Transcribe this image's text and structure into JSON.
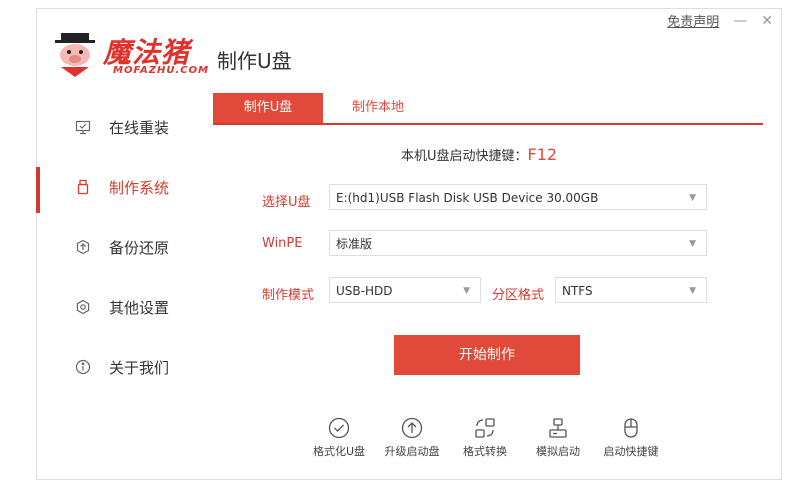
{
  "window": {
    "disclaimer": "免责声明",
    "minimize_glyph": "—",
    "close_glyph": "✕"
  },
  "logo": {
    "brand_text": "魔法猪",
    "brand_sub": "MOFAZHU.COM"
  },
  "page_title": "制作U盘",
  "sidebar": {
    "items": [
      {
        "label": "在线重装",
        "icon": "monitor-icon"
      },
      {
        "label": "制作系统",
        "icon": "usb-icon",
        "active": true
      },
      {
        "label": "备份还原",
        "icon": "backup-icon"
      },
      {
        "label": "其他设置",
        "icon": "gear-icon"
      },
      {
        "label": "关于我们",
        "icon": "info-icon"
      }
    ]
  },
  "tabs": [
    {
      "label": "制作U盘",
      "active": true
    },
    {
      "label": "制作本地",
      "active": false
    }
  ],
  "hotkey": {
    "label": "本机U盘启动快捷键：",
    "key": "F12"
  },
  "form": {
    "usb_label": "选择U盘",
    "usb_value": "E:(hd1)USB Flash Disk USB Device 30.00GB",
    "winpe_label": "WinPE",
    "winpe_value": "标准版",
    "mode_label": "制作模式",
    "mode_value": "USB-HDD",
    "partition_label": "分区格式",
    "partition_value": "NTFS",
    "caret_glyph": "▼"
  },
  "start_button": "开始制作",
  "tools": [
    {
      "label": "格式化U盘",
      "icon": "check-circle-icon"
    },
    {
      "label": "升级启动盘",
      "icon": "upload-circle-icon"
    },
    {
      "label": "格式转换",
      "icon": "convert-icon"
    },
    {
      "label": "模拟启动",
      "icon": "simulate-icon"
    },
    {
      "label": "启动快捷键",
      "icon": "mouse-icon"
    }
  ],
  "colors": {
    "accent": "#e14a3a",
    "accent_dark": "#d53a2f"
  }
}
